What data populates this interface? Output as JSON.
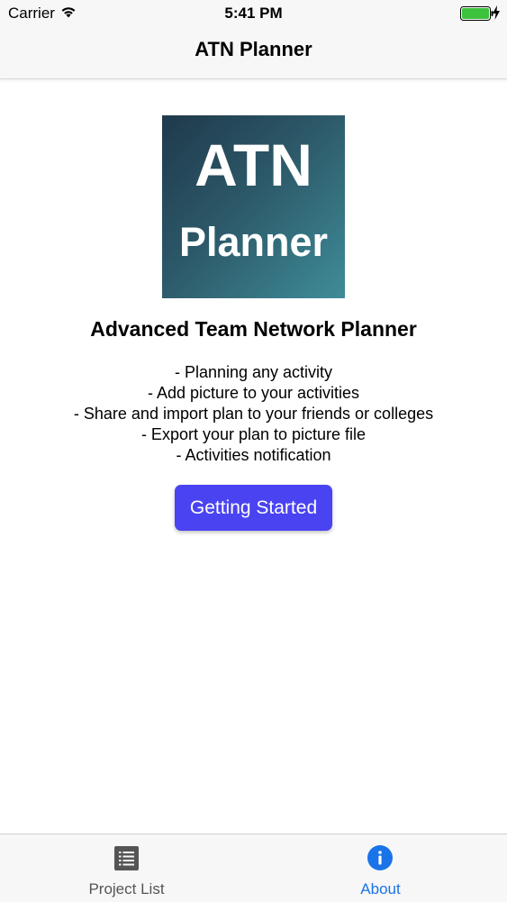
{
  "status_bar": {
    "carrier": "Carrier",
    "time": "5:41 PM",
    "icons": [
      "wifi-icon",
      "battery-icon",
      "charging-bolt-icon"
    ]
  },
  "nav": {
    "title": "ATN Planner"
  },
  "logo": {
    "line1": "ATN",
    "line2": "Planner"
  },
  "main": {
    "subtitle": "Advanced Team Network Planner",
    "features": [
      "- Planning any activity",
      "- Add picture to your activities",
      "- Share and import plan to your friends or colleges",
      "- Export your plan to picture file",
      "- Activities notification"
    ],
    "button_label": "Getting Started"
  },
  "tab_bar": {
    "tabs": [
      {
        "label": "Project List",
        "icon": "list-icon",
        "selected": false
      },
      {
        "label": "About",
        "icon": "info-icon",
        "selected": true
      }
    ]
  },
  "colors": {
    "accent": "#1a73e8",
    "button": "#4a43f2",
    "inactive": "#555555"
  }
}
